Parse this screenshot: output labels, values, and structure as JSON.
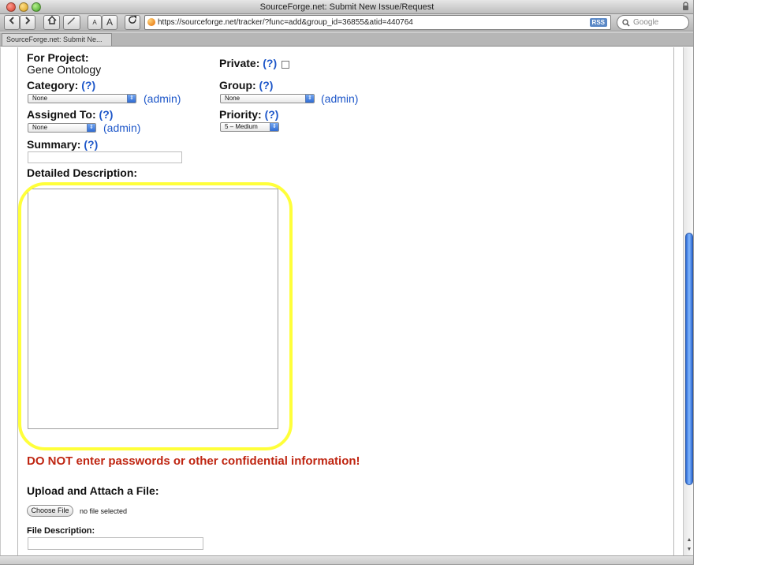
{
  "window": {
    "title": "SourceForge.net: Submit New Issue/Request",
    "tab_label": "SourceForge.net: Submit Ne..."
  },
  "toolbar": {
    "url": "https://sourceforge.net/tracker/?func=add&group_id=36855&atid=440764",
    "rss_label": "RSS",
    "search_placeholder": "Google",
    "small_text_label": "A",
    "large_text_label": "A"
  },
  "form": {
    "for_project_label": "For Project:",
    "project_name": "Gene Ontology",
    "private_label": "Private:",
    "help_label": "(?)",
    "category_label": "Category:",
    "category_value": "None",
    "group_label": "Group:",
    "group_value": "None",
    "admin_label": "(admin)",
    "assigned_to_label": "Assigned To:",
    "assigned_to_value": "None",
    "priority_label": "Priority:",
    "priority_value": "5 – Medium",
    "summary_label": "Summary:",
    "detailed_description_label": "Detailed Description:",
    "warning_text": "DO NOT enter passwords or other confidential information!",
    "upload_label": "Upload and Attach a File:",
    "choose_file_label": "Choose File",
    "file_status": "no file selected",
    "file_description_label": "File Description:"
  },
  "colors": {
    "link_blue": "#1e57c9",
    "warning_red": "#bf2612",
    "highlight_yellow": "#ffff3a"
  },
  "icons": [
    "back-arrow-icon",
    "forward-arrow-icon",
    "home-icon",
    "edit-icon",
    "reload-icon",
    "search-icon",
    "lock-icon"
  ]
}
